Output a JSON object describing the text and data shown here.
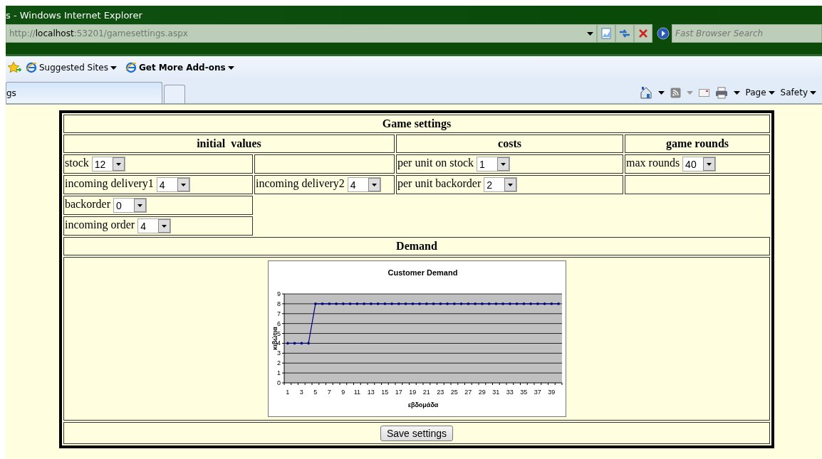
{
  "window": {
    "title": "s - Windows Internet Explorer"
  },
  "address_bar": {
    "url": "http://**localhost**:53201/gamesettings.aspx"
  },
  "search": {
    "placeholder": "Fast Browser Search"
  },
  "favorites_bar": [
    {
      "label": "Suggested Sites",
      "bold": false
    },
    {
      "label": "Get More Add-ons",
      "bold": true
    }
  ],
  "tabs": [
    {
      "label": "gs",
      "selected": true
    }
  ],
  "command_bar": [
    "Page",
    "Safety"
  ],
  "form": {
    "rows": [
      [
        {
          "kind": "heading",
          "text": "Game settings",
          "colspan": 4
        }
      ],
      [
        {
          "kind": "heading",
          "text": "initial  values",
          "colspan": 2
        },
        {
          "kind": "heading",
          "text": "costs"
        },
        {
          "kind": "heading",
          "text": "game rounds"
        }
      ],
      [
        {
          "kind": "field",
          "label": "stock",
          "value": "12"
        },
        {
          "kind": "empty"
        },
        {
          "kind": "field",
          "label": "per unit on stock",
          "value": "1"
        },
        {
          "kind": "field",
          "label": "max rounds",
          "value": "40"
        }
      ],
      [
        {
          "kind": "field",
          "label": "incoming delivery1",
          "value": "4"
        },
        {
          "kind": "field",
          "label": "incoming delivery2",
          "value": "4"
        },
        {
          "kind": "field",
          "label": "per unit backorder",
          "value": "2"
        },
        {
          "kind": "empty"
        }
      ],
      [
        {
          "kind": "field",
          "label": "backorder",
          "value": "0"
        }
      ],
      [
        {
          "kind": "field",
          "label": "incoming order",
          "value": "4"
        }
      ],
      [
        {
          "kind": "heading",
          "text": "Demand",
          "colspan": 4
        }
      ],
      [
        {
          "kind": "chart",
          "colspan": 4
        }
      ],
      [
        {
          "kind": "button",
          "text": "Save settings",
          "colspan": 4
        }
      ]
    ],
    "chart_data": {
      "type": "line",
      "title": "Customer Demand",
      "xlabel": "εβδομάδα",
      "ylabel": "κιβώτια",
      "x": [
        1,
        2,
        3,
        4,
        5,
        6,
        7,
        8,
        9,
        10,
        11,
        12,
        13,
        14,
        15,
        16,
        17,
        18,
        19,
        20,
        21,
        22,
        23,
        24,
        25,
        26,
        27,
        28,
        29,
        30,
        31,
        32,
        33,
        34,
        35,
        36,
        37,
        38,
        39,
        40
      ],
      "series": [
        {
          "color": "#000080",
          "values": [
            4,
            4,
            4,
            4,
            8,
            8,
            8,
            8,
            8,
            8,
            8,
            8,
            8,
            8,
            8,
            8,
            8,
            8,
            8,
            8,
            8,
            8,
            8,
            8,
            8,
            8,
            8,
            8,
            8,
            8,
            8,
            8,
            8,
            8,
            8,
            8,
            8,
            8,
            8,
            8
          ]
        }
      ],
      "xticks": [
        1,
        3,
        5,
        7,
        9,
        11,
        13,
        15,
        17,
        19,
        21,
        23,
        25,
        27,
        29,
        31,
        33,
        35,
        37,
        39
      ],
      "yticks": [
        0,
        1,
        2,
        3,
        4,
        5,
        6,
        7,
        8,
        9
      ],
      "xlim": [
        0.5,
        40.5
      ],
      "ylim": [
        0,
        9
      ],
      "grid": true
    }
  }
}
